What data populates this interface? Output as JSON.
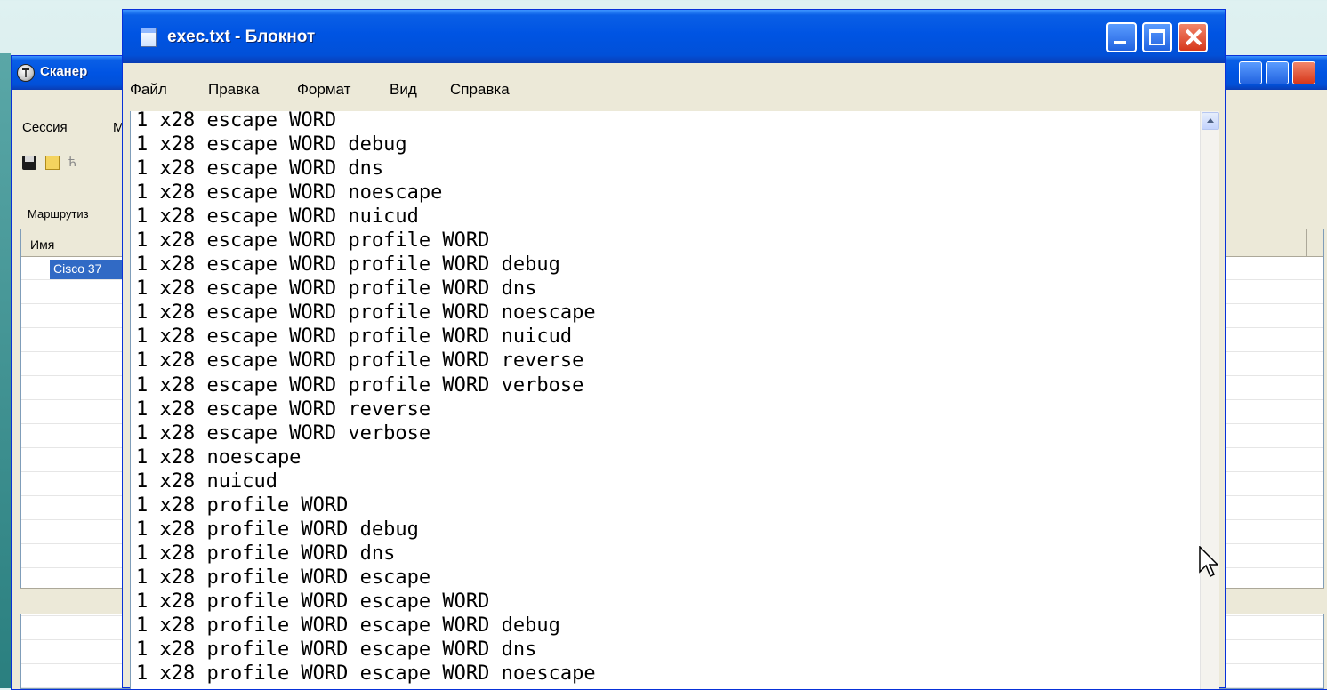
{
  "background_window": {
    "title": "Сканер",
    "menu": [
      "Сессия",
      "М"
    ],
    "tab_label": "Маршрутиз",
    "list_column_name": "Имя",
    "selected_row": "Cisco 37"
  },
  "notepad": {
    "title": "exec.txt - Блокнот",
    "menu": [
      "Файл",
      "Правка",
      "Формат",
      "Вид",
      "Справка"
    ],
    "lines": [
      "1 x28 escape WORD",
      "1 x28 escape WORD debug",
      "1 x28 escape WORD dns",
      "1 x28 escape WORD noescape",
      "1 x28 escape WORD nuicud",
      "1 x28 escape WORD profile WORD",
      "1 x28 escape WORD profile WORD debug",
      "1 x28 escape WORD profile WORD dns",
      "1 x28 escape WORD profile WORD noescape",
      "1 x28 escape WORD profile WORD nuicud",
      "1 x28 escape WORD profile WORD reverse",
      "1 x28 escape WORD profile WORD verbose",
      "1 x28 escape WORD reverse",
      "1 x28 escape WORD verbose",
      "1 x28 noescape",
      "1 x28 nuicud",
      "1 x28 profile WORD",
      "1 x28 profile WORD debug",
      "1 x28 profile WORD dns",
      "1 x28 profile WORD escape",
      "1 x28 profile WORD escape WORD",
      "1 x28 profile WORD escape WORD debug",
      "1 x28 profile WORD escape WORD dns",
      "1 x28 profile WORD escape WORD noescape"
    ]
  },
  "colors": {
    "titlebar_blue": "#0054e3",
    "close_red": "#d6371a",
    "selection": "#316ac5"
  }
}
